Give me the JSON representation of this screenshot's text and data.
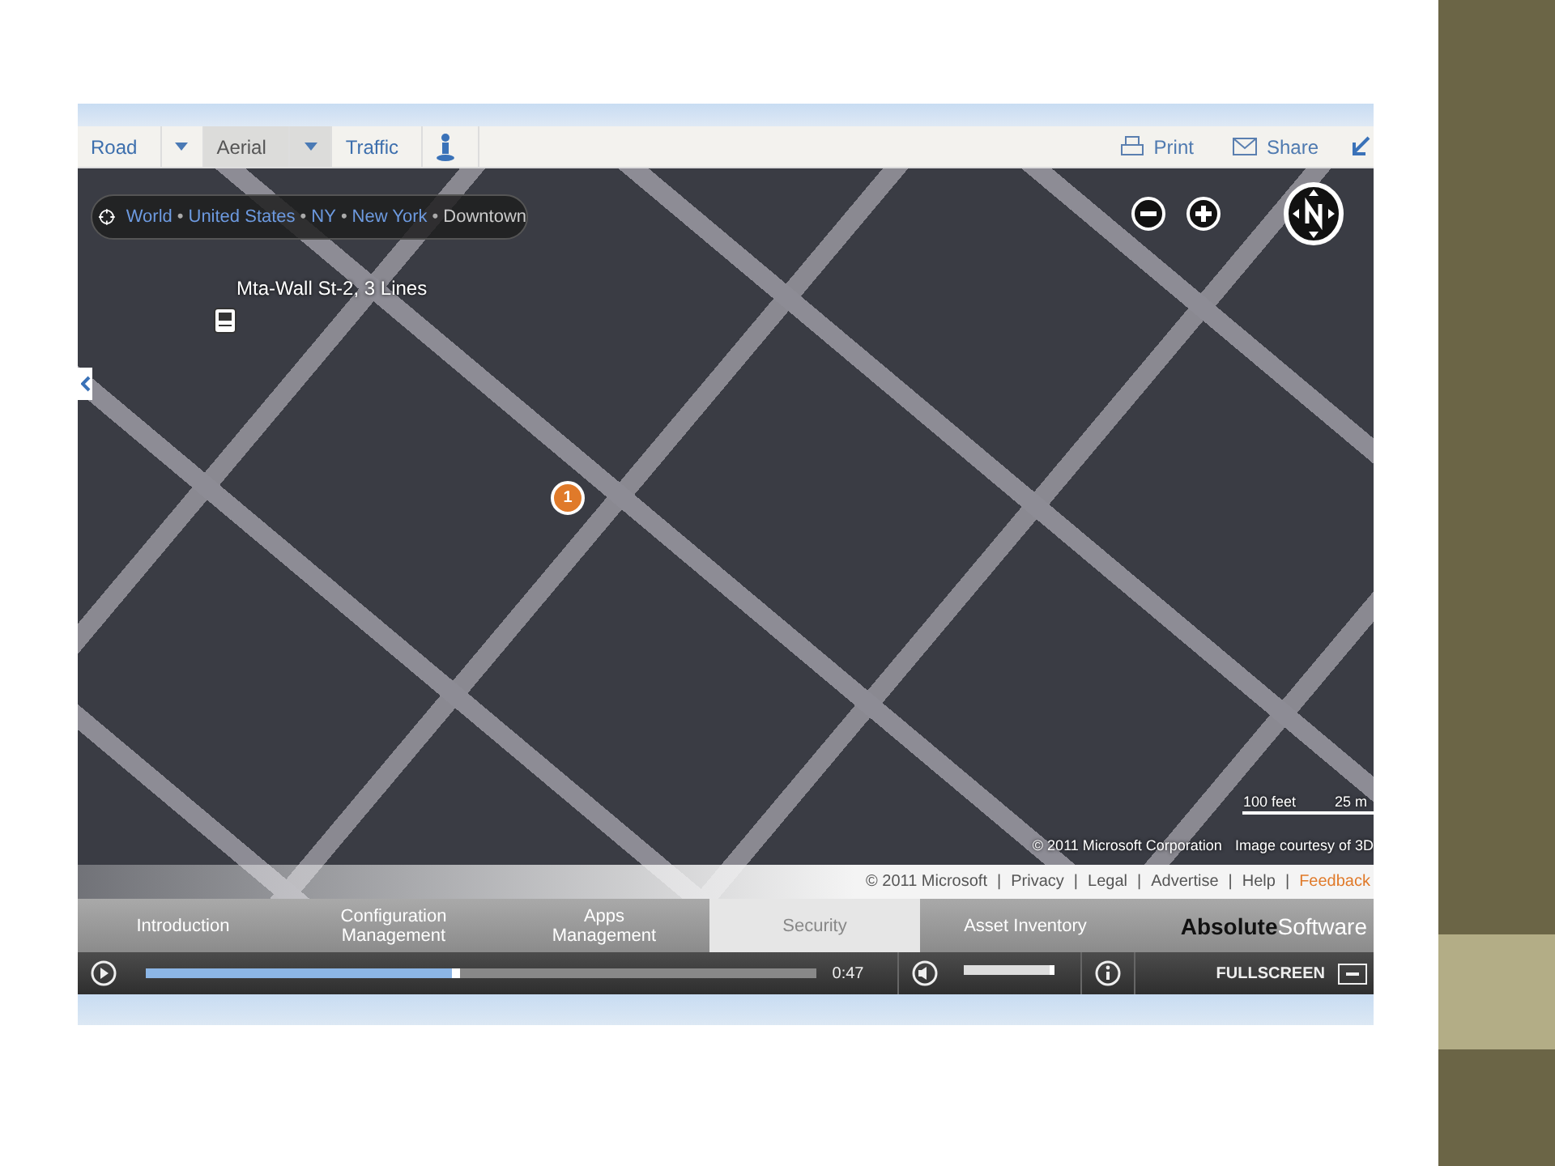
{
  "toolbar": {
    "views": [
      {
        "label": "Road",
        "selected": false,
        "dropdown": true
      },
      {
        "label": "Aerial",
        "selected": true,
        "dropdown": true
      },
      {
        "label": "Traffic",
        "selected": false,
        "dropdown": false
      }
    ],
    "actions": [
      {
        "label": "Print",
        "kind": "print"
      },
      {
        "label": "Share",
        "kind": "mail"
      }
    ]
  },
  "map": {
    "breadcrumb_separator": "•",
    "breadcrumb": [
      {
        "label": "World",
        "link": true
      },
      {
        "label": "United States",
        "link": true
      },
      {
        "label": "NY",
        "link": true
      },
      {
        "label": "New York",
        "link": true
      },
      {
        "label": "Downtown",
        "link": false
      }
    ],
    "transit_label": "Mta-Wall St-2, 3 Lines",
    "pin": "1",
    "scale": [
      "100 feet",
      "25 m"
    ],
    "attribution": "© 2011 Microsoft Corporation",
    "credit": "Image courtesy of 3D"
  },
  "footer": {
    "copyright": "© 2011 Microsoft",
    "separator": "|",
    "links": [
      {
        "label": "Privacy",
        "highlighted": false
      },
      {
        "label": "Legal",
        "highlighted": false
      },
      {
        "label": "Advertise",
        "highlighted": false
      },
      {
        "label": "Help",
        "highlighted": false
      },
      {
        "label": "Feedback",
        "highlighted": true
      }
    ]
  },
  "chapters": [
    {
      "label": "Introduction",
      "selected": false
    },
    {
      "label": "Configuration Management",
      "selected": false
    },
    {
      "label": "Apps Management",
      "selected": false
    },
    {
      "label": "Security",
      "selected": true
    },
    {
      "label": "Asset Inventory",
      "selected": false
    }
  ],
  "brand": "**Absolute**Software",
  "player": {
    "level": 0.47,
    "time": "0:47",
    "volume": {
      "level": 0.95
    },
    "fullscreen": "FULLSCREEN"
  }
}
